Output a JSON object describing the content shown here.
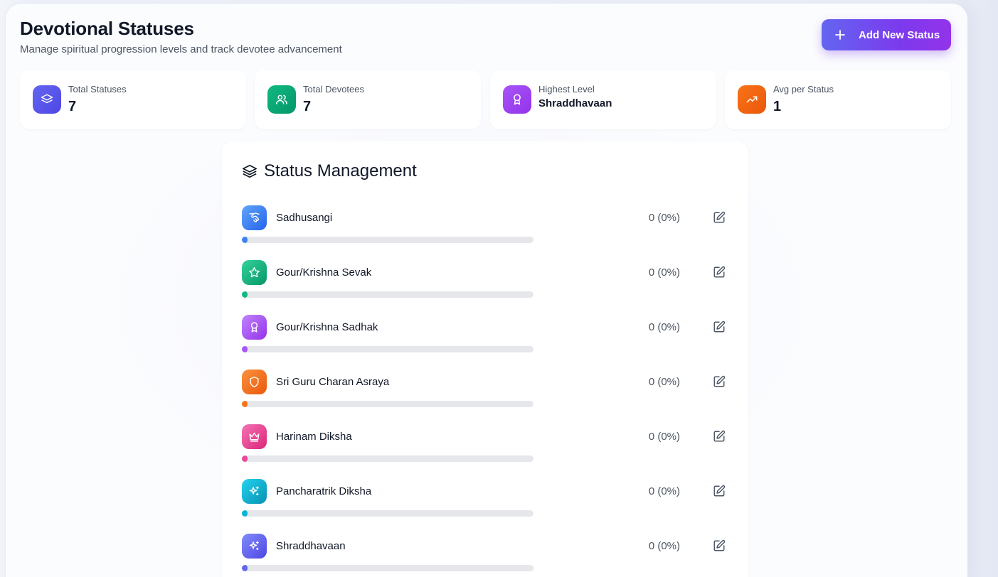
{
  "header": {
    "title": "Devotional Statuses",
    "subtitle": "Manage spiritual progression levels and track devotee advancement",
    "add_button_label": "Add New Status"
  },
  "stats": [
    {
      "label": "Total Statuses",
      "value": "7",
      "icon": "layers-icon",
      "color_from": "#6366f1",
      "color_to": "#4f46e5"
    },
    {
      "label": "Total Devotees",
      "value": "7",
      "icon": "users-icon",
      "color_from": "#10b981",
      "color_to": "#059669"
    },
    {
      "label": "Highest Level",
      "value": "Shraddhavaan",
      "icon": "award-icon",
      "color_from": "#a855f7",
      "color_to": "#9333ea"
    },
    {
      "label": "Avg per Status",
      "value": "1",
      "icon": "trending-up-icon",
      "color_from": "#f97316",
      "color_to": "#ea580c"
    }
  ],
  "management": {
    "title": "Status Management",
    "statuses": [
      {
        "name": "Sadhusangi",
        "count": "0 (0%)",
        "percent": 0,
        "icon": "handshake-icon",
        "color_from": "#60a5fa",
        "color_to": "#2563eb"
      },
      {
        "name": "Gour/Krishna Sevak",
        "count": "0 (0%)",
        "percent": 0,
        "icon": "star-icon",
        "color_from": "#34d399",
        "color_to": "#059669"
      },
      {
        "name": "Gour/Krishna Sadhak",
        "count": "0 (0%)",
        "percent": 0,
        "icon": "award-icon",
        "color_from": "#c084fc",
        "color_to": "#9333ea"
      },
      {
        "name": "Sri Guru Charan Asraya",
        "count": "0 (0%)",
        "percent": 0,
        "icon": "shield-icon",
        "color_from": "#fb923c",
        "color_to": "#ea580c"
      },
      {
        "name": "Harinam Diksha",
        "count": "0 (0%)",
        "percent": 0,
        "icon": "crown-icon",
        "color_from": "#f472b6",
        "color_to": "#db2777"
      },
      {
        "name": "Pancharatrik Diksha",
        "count": "0 (0%)",
        "percent": 0,
        "icon": "sparkles-icon",
        "color_from": "#22d3ee",
        "color_to": "#0891b2"
      },
      {
        "name": "Shraddhavaan",
        "count": "0 (0%)",
        "percent": 0,
        "icon": "sparkles-icon",
        "color_from": "#818cf8",
        "color_to": "#4f46e5"
      }
    ]
  }
}
